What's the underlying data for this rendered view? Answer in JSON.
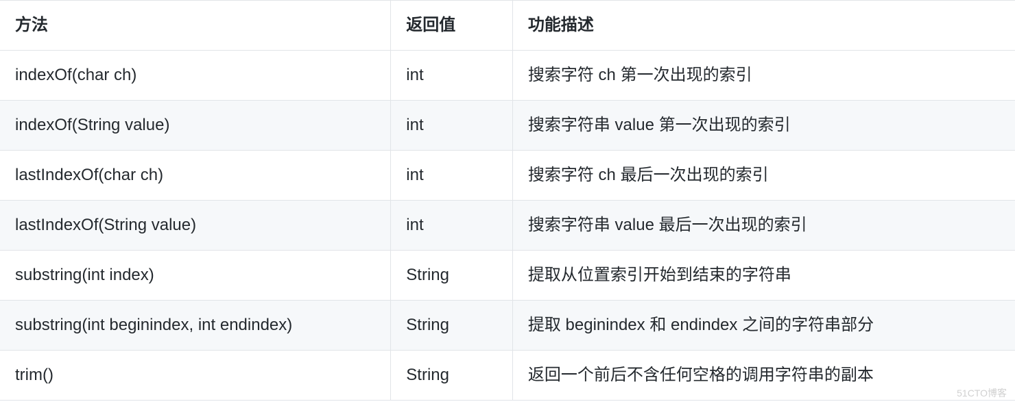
{
  "table": {
    "headers": {
      "method": "方法",
      "returnValue": "返回值",
      "description": "功能描述"
    },
    "rows": [
      {
        "method": "indexOf(char ch)",
        "returnValue": "int",
        "description": "搜索字符 ch 第一次出现的索引"
      },
      {
        "method": "indexOf(String value)",
        "returnValue": "int",
        "description": "搜索字符串 value 第一次出现的索引"
      },
      {
        "method": "lastIndexOf(char ch)",
        "returnValue": "int",
        "description": "搜索字符 ch 最后一次出现的索引"
      },
      {
        "method": "lastIndexOf(String value)",
        "returnValue": "int",
        "description": "搜索字符串 value 最后一次出现的索引"
      },
      {
        "method": "substring(int index)",
        "returnValue": "String",
        "description": "提取从位置索引开始到结束的字符串"
      },
      {
        "method": "substring(int beginindex, int endindex)",
        "returnValue": "String",
        "description": "提取 beginindex 和 endindex 之间的字符串部分"
      },
      {
        "method": "trim()",
        "returnValue": "String",
        "description": "返回一个前后不含任何空格的调用字符串的副本"
      }
    ]
  },
  "watermark": "51CTO博客"
}
